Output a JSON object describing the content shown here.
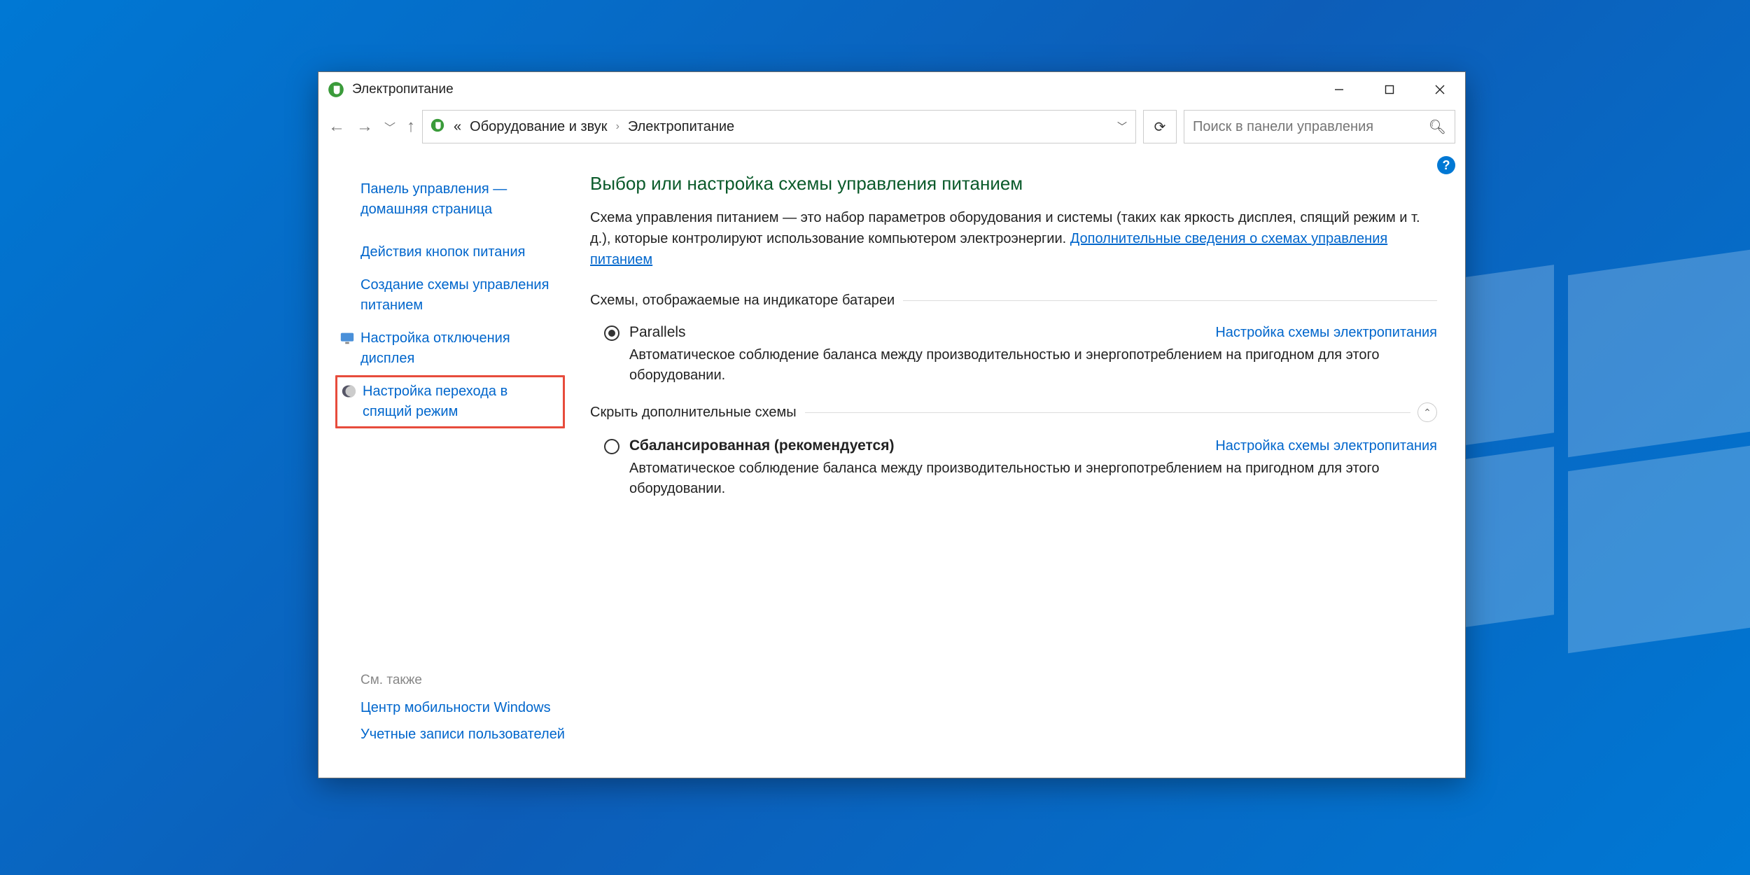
{
  "window": {
    "title": "Электропитание"
  },
  "address": {
    "prefix": "«",
    "crumb1": "Оборудование и звук",
    "crumb2": "Электропитание"
  },
  "search": {
    "placeholder": "Поиск в панели управления"
  },
  "sidebar": {
    "home": "Панель управления — домашняя страница",
    "items": [
      {
        "label": "Действия кнопок питания"
      },
      {
        "label": "Создание схемы управления питанием"
      },
      {
        "label": "Настройка отключения дисплея"
      },
      {
        "label": "Настройка перехода в спящий режим"
      }
    ],
    "see_also_hdr": "См. также",
    "see_also": [
      "Центр мобильности Windows",
      "Учетные записи пользователей"
    ]
  },
  "main": {
    "heading": "Выбор или настройка схемы управления питанием",
    "desc1": "Схема управления питанием — это набор параметров оборудования и системы (таких как яркость дисплея, спящий режим и т. д.), которые контролируют использование компьютером электроэнергии. ",
    "desc_link": "Дополнительные сведения о схемах управления питанием",
    "section1": "Схемы, отображаемые на индикаторе батареи",
    "section2": "Скрыть дополнительные схемы",
    "plan_cfg": "Настройка схемы электропитания",
    "plans": [
      {
        "name": "Parallels",
        "desc": "Автоматическое соблюдение баланса между производительностью и энергопотреблением на пригодном для этого оборудовании."
      },
      {
        "name": "Сбалансированная (рекомендуется)",
        "desc": "Автоматическое соблюдение баланса между производительностью и энергопотреблением на пригодном для этого оборудовании."
      }
    ]
  }
}
